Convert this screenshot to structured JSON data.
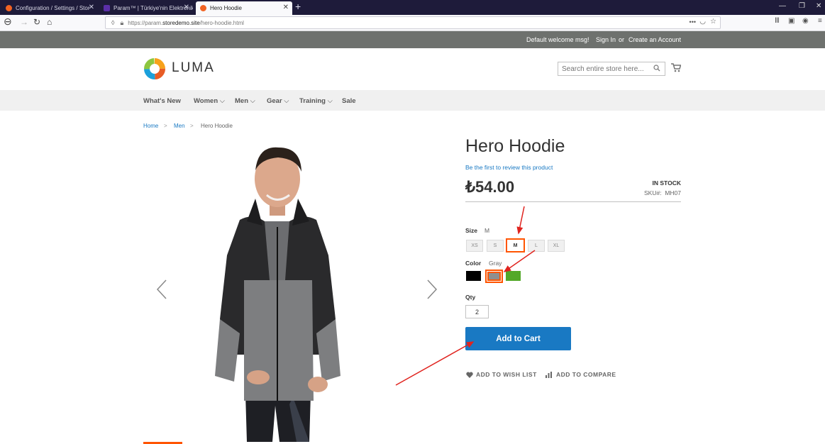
{
  "browser": {
    "tabs": [
      {
        "title": "Configuration / Settings / Stor",
        "icon": "magento-favicon"
      },
      {
        "title": "Param™ | Türkiye'nin Elektronik",
        "icon": "param-favicon"
      },
      {
        "title": "Hero Hoodie",
        "icon": "magento-favicon"
      }
    ],
    "url_prefix": "https://param.",
    "url_domain": "storedemo.site",
    "url_path": "/hero-hoodie.html"
  },
  "header": {
    "welcome": "Default welcome msg!",
    "sign_in": "Sign In",
    "or": "or",
    "create_account": "Create an Account",
    "logo_text": "LUMA",
    "search_placeholder": "Search entire store here..."
  },
  "nav": {
    "items": [
      "What's New",
      "Women",
      "Men",
      "Gear",
      "Training",
      "Sale"
    ]
  },
  "breadcrumbs": {
    "home": "Home",
    "category": "Men",
    "current": "Hero Hoodie",
    "sep": ">"
  },
  "product": {
    "title": "Hero Hoodie",
    "review_link": "Be the first to review this product",
    "price": "₺54.00",
    "stock": "IN STOCK",
    "sku_label": "SKU#:",
    "sku": "MH07",
    "size_label": "Size",
    "size_selected": "M",
    "sizes": [
      "XS",
      "S",
      "M",
      "L",
      "XL"
    ],
    "color_label": "Color",
    "color_selected": "Gray",
    "colors": [
      "#000000",
      "#8f8f8f",
      "#53a828"
    ],
    "qty_label": "Qty",
    "qty": "2",
    "add_to_cart": "Add to Cart",
    "wishlist": "ADD TO WISH LIST",
    "compare": "ADD TO COMPARE"
  },
  "colors": {
    "accent": "#1979c3",
    "selection": "#ff5501",
    "annotation": "#e0231e"
  }
}
